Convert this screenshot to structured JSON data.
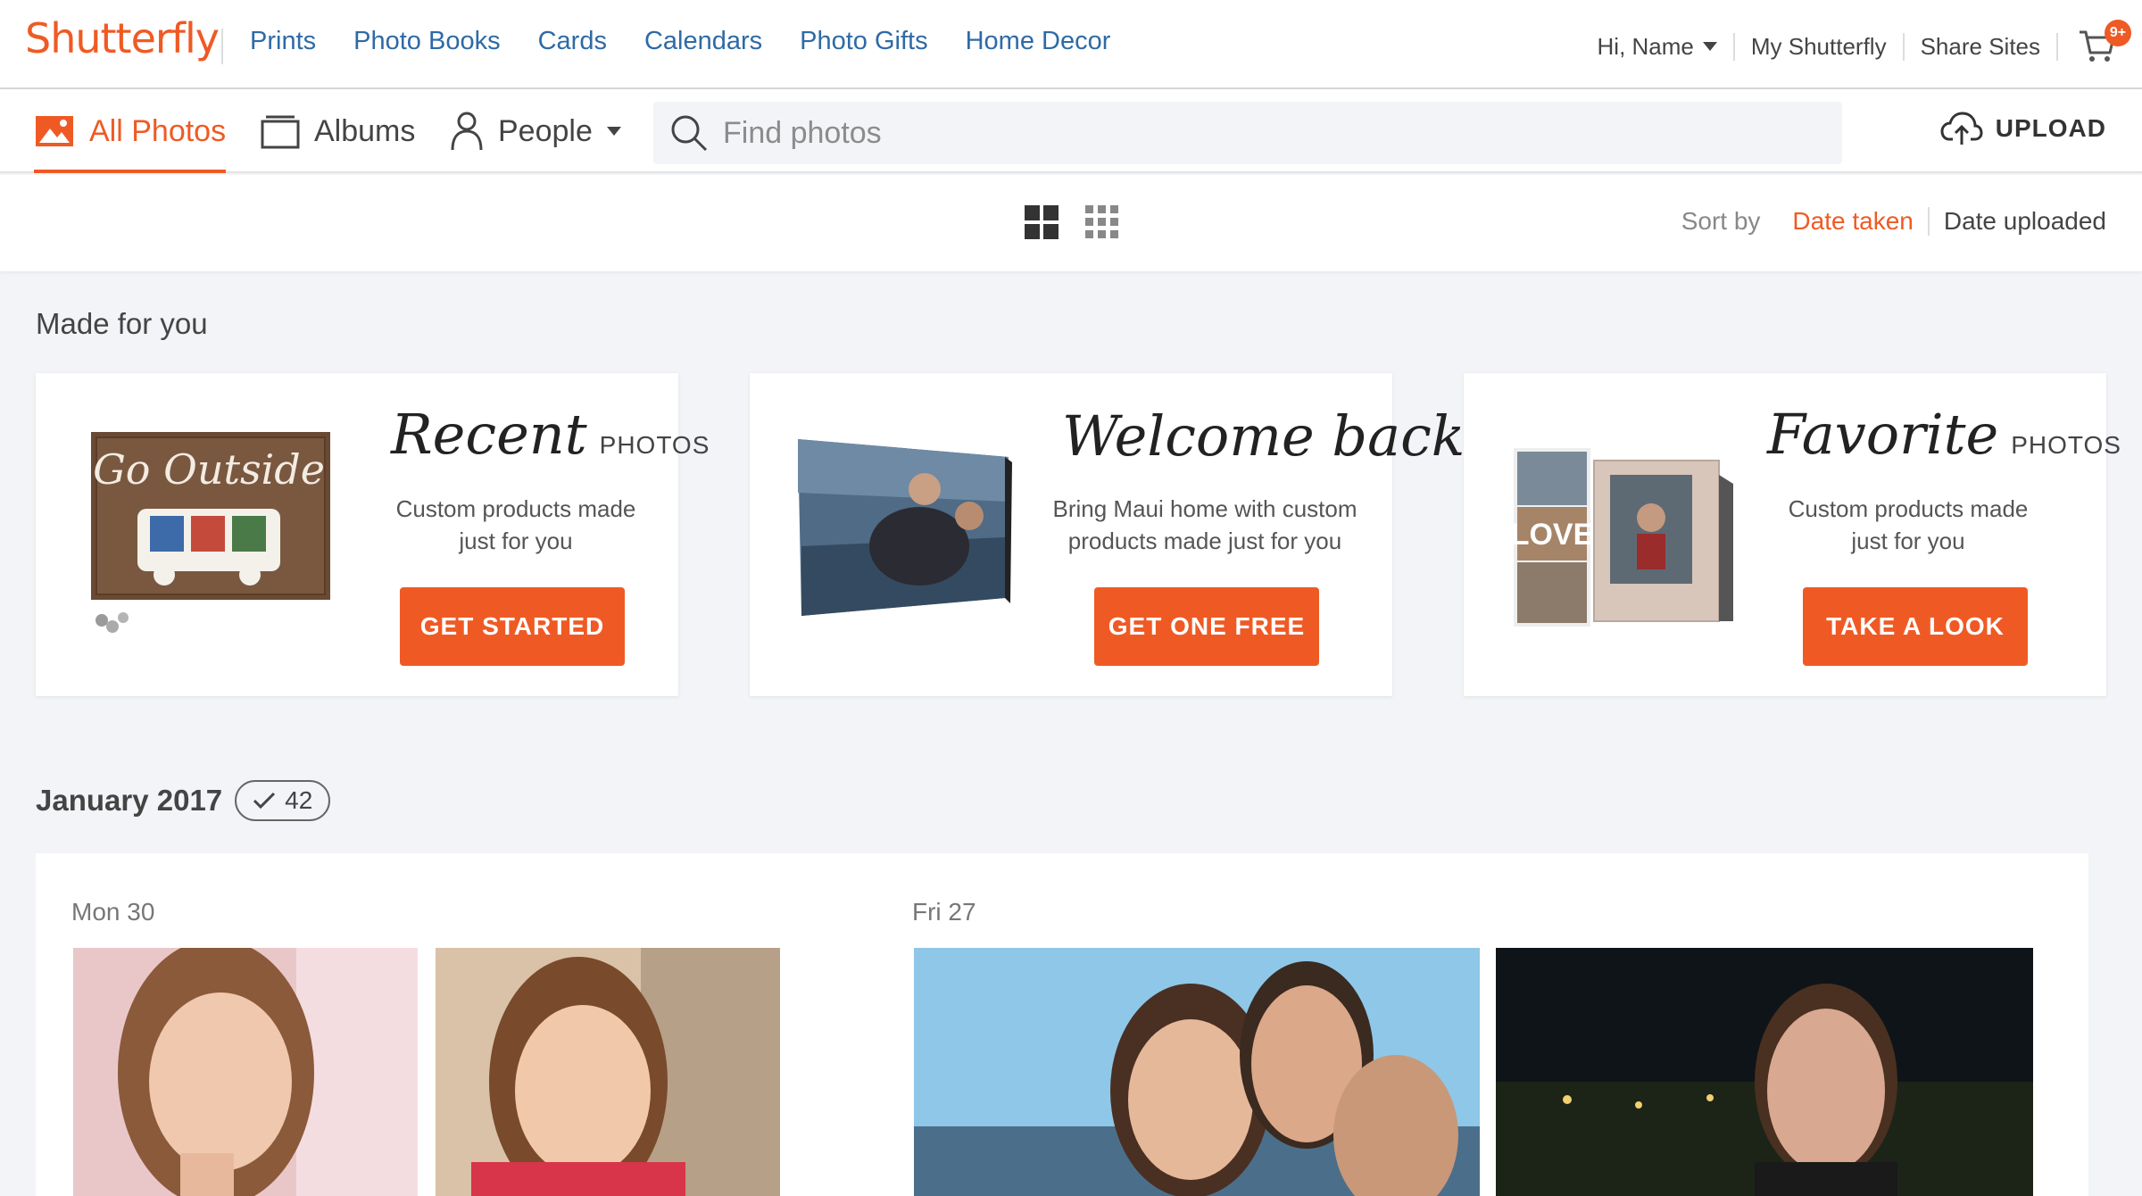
{
  "brand": {
    "logo_text": "Shutterfly",
    "accent": "#ef5a24",
    "link_color": "#2e6aa6"
  },
  "topnav": {
    "links": [
      "Prints",
      "Photo Books",
      "Cards",
      "Calendars",
      "Photo Gifts",
      "Home Decor"
    ],
    "greeting": "Hi, Name",
    "my_account": "My Shutterfly",
    "share_sites": "Share Sites",
    "cart_badge": "9+",
    "cart_icon": "cart-icon"
  },
  "subnav": {
    "tabs": [
      {
        "label": "All Photos",
        "icon": "image-icon",
        "active": true
      },
      {
        "label": "Albums",
        "icon": "album-icon",
        "active": false
      },
      {
        "label": "People",
        "icon": "person-icon",
        "active": false
      }
    ],
    "search_placeholder": "Find photos",
    "upload_label": "UPLOAD"
  },
  "toolbar": {
    "view_options": [
      "large-grid-icon",
      "small-grid-icon"
    ],
    "sort_label": "Sort by",
    "sort_options": [
      {
        "label": "Date taken",
        "active": true
      },
      {
        "label": "Date uploaded",
        "active": false
      }
    ]
  },
  "made_for_you": {
    "title": "Made for you",
    "cards": [
      {
        "script": "Recent",
        "suffix": "PHOTOS",
        "description_line1": "Custom products made",
        "description_line2": "just for you",
        "cta": "GET STARTED",
        "image_text": "Go Outside"
      },
      {
        "script": "Welcome back!",
        "suffix": "",
        "description_line1": "Bring Maui home with custom",
        "description_line2": "products made just for you",
        "cta": "GET ONE FREE"
      },
      {
        "script": "Favorite",
        "suffix": "PHOTOS",
        "description_line1": "Custom products made",
        "description_line2": "just for you",
        "cta": "TAKE A LOOK",
        "image_text": "LOVE"
      }
    ]
  },
  "timeline": {
    "month": "January 2017",
    "count": "42",
    "days": [
      {
        "label": "Mon 30"
      },
      {
        "label": "Fri 27"
      }
    ]
  }
}
